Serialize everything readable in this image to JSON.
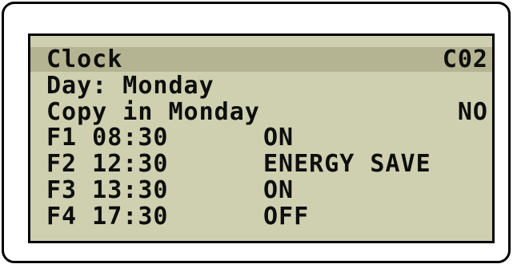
{
  "screen": {
    "header": {
      "title": "Clock",
      "code": "C02"
    },
    "day_line": "Day: Monday",
    "copy_line": {
      "label": "Copy in Monday",
      "value": "NO"
    },
    "schedule": [
      {
        "slot": "F1 08:30",
        "mode": "ON"
      },
      {
        "slot": "F2 12:30",
        "mode": "ENERGY SAVE"
      },
      {
        "slot": "F3 13:30",
        "mode": "ON"
      },
      {
        "slot": "F4 17:30",
        "mode": "OFF"
      }
    ]
  },
  "colors": {
    "lcd_background": "#cfd0b0",
    "header_highlight": "#b4b493",
    "text": "#0e0e0e"
  }
}
